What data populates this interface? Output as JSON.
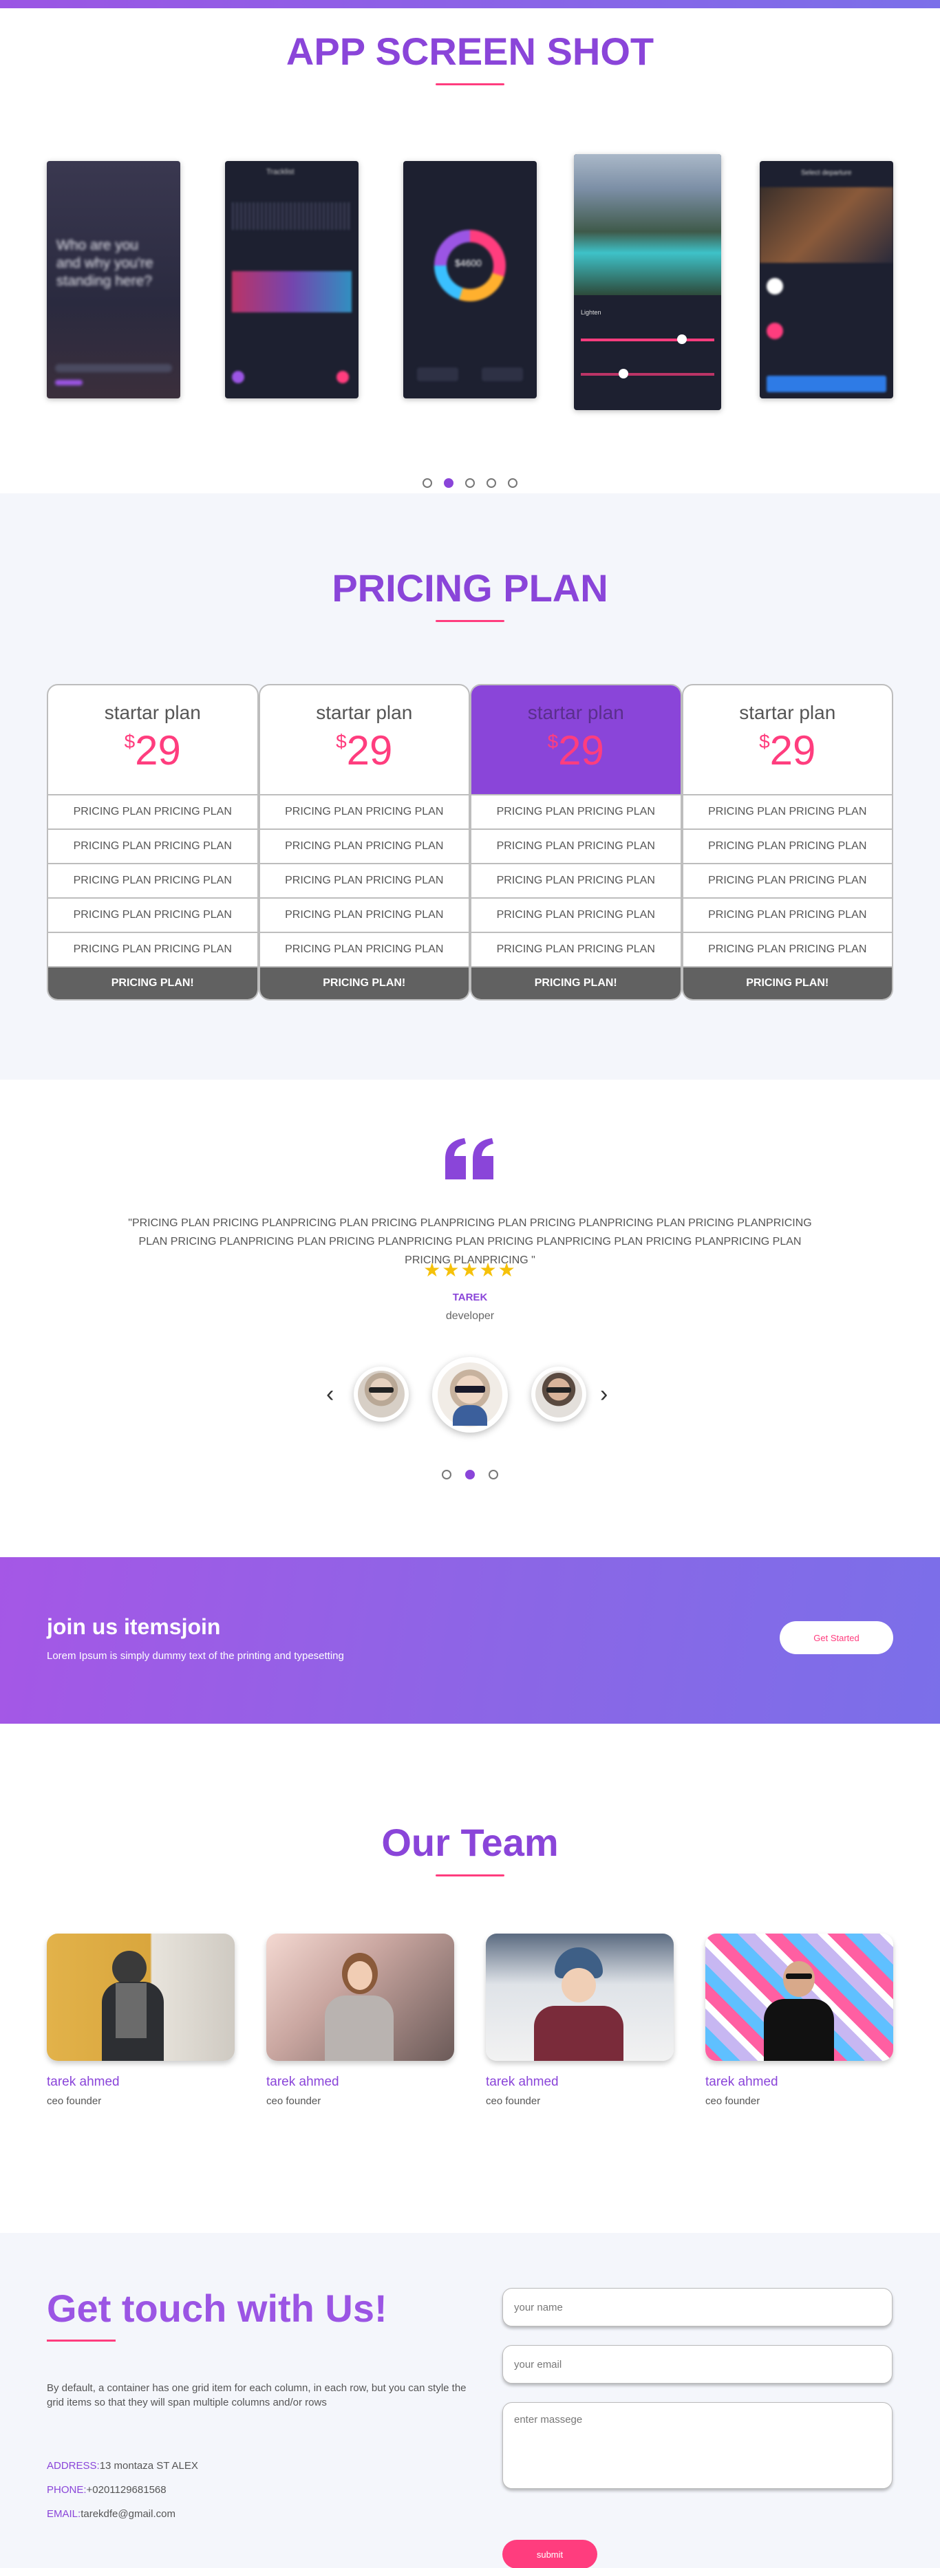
{
  "screenshots": {
    "title": "APP SCREEN SHOT",
    "phones": [
      {
        "label": "Who are you and why you're standing here?"
      },
      {
        "label": "Tracklist"
      },
      {
        "label": "$4600"
      },
      {
        "label": "Lighten"
      },
      {
        "label": "Select departure"
      }
    ],
    "dots": 5,
    "active_dot": 1
  },
  "pricing": {
    "title": "PRICING PLAN",
    "plans": [
      {
        "name": "startar plan",
        "currency": "$",
        "amount": "29",
        "featured": false
      },
      {
        "name": "startar plan",
        "currency": "$",
        "amount": "29",
        "featured": false
      },
      {
        "name": "startar plan",
        "currency": "$",
        "amount": "29",
        "featured": true
      },
      {
        "name": "startar plan",
        "currency": "$",
        "amount": "29",
        "featured": false
      }
    ],
    "row_text": "PRICING PLAN PRICING PLAN",
    "button_label": "PRICING PLAN!"
  },
  "testimonial": {
    "text": "\"PRICING PLAN PRICING PLANPRICING PLAN PRICING PLANPRICING PLAN PRICING PLANPRICING PLAN PRICING PLANPRICING PLAN PRICING PLANPRICING PLAN PRICING PLANPRICING PLAN PRICING PLANPRICING PLAN PRICING PLANPRICING PLAN PRICING PLANPRICING \"",
    "stars": "★★★★★",
    "name": "TAREK",
    "role": "developer",
    "prev_icon": "chevron-left-icon",
    "next_icon": "chevron-right-icon",
    "dots": 3,
    "active_dot": 1
  },
  "join": {
    "title": "join us itemsjoin",
    "subtitle": "Lorem Ipsum is simply dummy text of the printing and typesetting",
    "button": "Get Started"
  },
  "team": {
    "title": "Our Team",
    "members": [
      {
        "name": "tarek ahmed",
        "role": "ceo founder"
      },
      {
        "name": "tarek ahmed",
        "role": "ceo founder"
      },
      {
        "name": "tarek ahmed",
        "role": "ceo founder"
      },
      {
        "name": "tarek ahmed",
        "role": "ceo founder"
      }
    ]
  },
  "contact": {
    "title": "Get touch with Us!",
    "description": "By default, a container has one grid item for each column, in each row, but you can style the grid items so that they will span multiple columns and/or rows",
    "address_label": "ADDRESS:",
    "address": "13 montaza ST ALEX",
    "phone_label": "PHONE:",
    "phone": "+0201129681568",
    "email_label": "EMAIL:",
    "email": "tarekdfe@gmail.com",
    "name_placeholder": "your name",
    "email_placeholder": "your email",
    "message_placeholder": "enter massege",
    "submit": "submit"
  },
  "colors": {
    "primary": "#8a45d9",
    "accent": "#ff3d7e",
    "star": "#f5c10a"
  }
}
